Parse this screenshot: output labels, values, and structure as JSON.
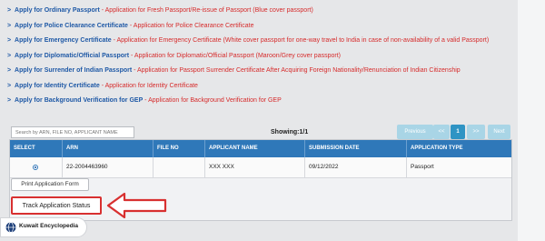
{
  "services": [
    {
      "title": "Apply for Ordinary Passport",
      "desc": "Application for Fresh Passport/Re-issue of Passport (Blue cover passport)"
    },
    {
      "title": "Apply for Police Clearance Certificate",
      "desc": "Application for Police Clearance Certificate"
    },
    {
      "title": "Apply for Emergency Certificate",
      "desc": "Application for Emergency Certificate (White cover passport for one-way travel to India in case of non-availability of a valid Passport)"
    },
    {
      "title": "Apply for Diplomatic/Official Passport",
      "desc": "Application for Diplomatic/Official Passport (Maroon/Grey cover passport)"
    },
    {
      "title": "Apply for Surrender of Indian Passport",
      "desc": "Application for Passport Surrender Certificate After Acquiring Foreign Nationality/Renunciation of Indian Citizenship"
    },
    {
      "title": "Apply for Identity Certificate",
      "desc": "Application for Identity Certificate"
    },
    {
      "title": "Apply for Background Verification for GEP",
      "desc": "Application for Background Verification for GEP"
    }
  ],
  "link_arrow": ">",
  "desc_separator": " - ",
  "search": {
    "placeholder": "Search by ARN, FILE NO, APPLICANT NAME"
  },
  "showing": "Showing:1/1",
  "pager": {
    "previous": "Previous",
    "first": "<<",
    "current": "1",
    "last": ">>",
    "next": "Next"
  },
  "table": {
    "headers": [
      "SELECT",
      "ARN",
      "FILE NO",
      "APPLICANT NAME",
      "SUBMISSION DATE",
      "APPLICATION TYPE"
    ],
    "rows": [
      {
        "arn": "22-2004463960",
        "file_no": "",
        "applicant_name": "XXX XXX",
        "submission_date": "09/12/2022",
        "application_type": "Passport",
        "selected": true
      }
    ]
  },
  "buttons": {
    "print": "Print Application Form",
    "track": "Track Application Status"
  },
  "logo": {
    "text": "Kuwait Encyclopedia"
  },
  "colors": {
    "link": "#1f59a6",
    "desc": "#d62b2b",
    "header": "#2f78b9",
    "annotation": "#d83030"
  }
}
